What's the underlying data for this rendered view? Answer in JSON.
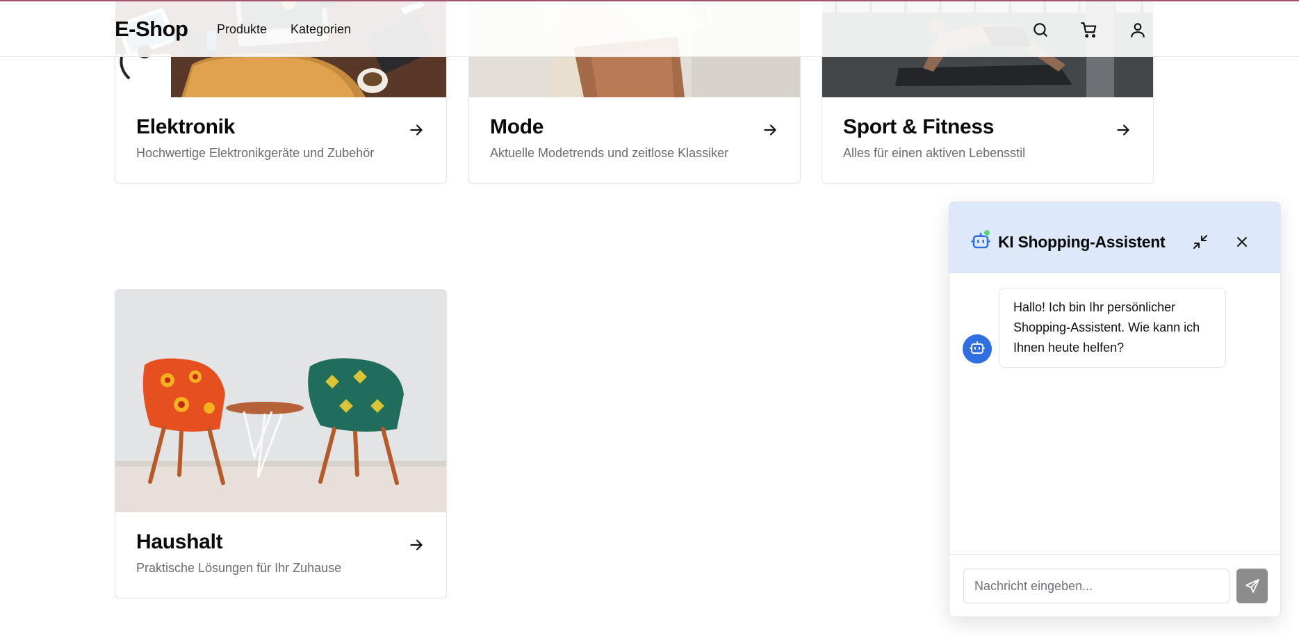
{
  "header": {
    "logo": "E-Shop",
    "nav": [
      {
        "label": "Produkte"
      },
      {
        "label": "Kategorien"
      }
    ],
    "icons": [
      "search-icon",
      "cart-icon",
      "user-icon"
    ]
  },
  "categories": [
    {
      "title": "Elektronik",
      "description": "Hochwertige Elektronikgeräte und Zubehör"
    },
    {
      "title": "Mode",
      "description": "Aktuelle Modetrends und zeitlose Klassiker"
    },
    {
      "title": "Sport & Fitness",
      "description": "Alles für einen aktiven Lebensstil"
    },
    {
      "title": "Haushalt",
      "description": "Praktische Lösungen für Ihr Zuhause"
    }
  ],
  "chat": {
    "title": "KI Shopping-Assistent",
    "messages": [
      {
        "sender": "bot",
        "text": "Hallo! Ich bin Ihr persönlicher Shopping-Assistent. Wie kann ich Ihnen heute helfen?"
      }
    ],
    "input_placeholder": "Nachricht eingeben...",
    "input_value": ""
  },
  "colors": {
    "chat_header_bg": "#dde9fb",
    "accent_blue": "#2f6fdf",
    "online_green": "#5bd37a",
    "send_button": "#8c8c8c",
    "top_border": "#a0526b"
  }
}
